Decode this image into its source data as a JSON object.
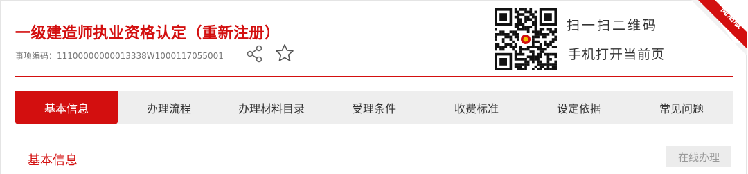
{
  "header": {
    "title": "一级建造师执业资格认定（重新注册）",
    "item_code": "事项编码：11100000000013338W1000117055001"
  },
  "qr": {
    "line1": "扫一扫二维码",
    "line2": "手机打开当前页"
  },
  "corner_badge": {
    "go": "GO",
    "label": "简洁版"
  },
  "tabs": [
    {
      "label": "基本信息",
      "active": true
    },
    {
      "label": "办理流程",
      "active": false
    },
    {
      "label": "办理材料目录",
      "active": false
    },
    {
      "label": "受理条件",
      "active": false
    },
    {
      "label": "收费标准",
      "active": false
    },
    {
      "label": "设定依据",
      "active": false
    },
    {
      "label": "常见问题",
      "active": false
    }
  ],
  "section": {
    "title": "基本信息",
    "online_button": "在线办理"
  },
  "colors": {
    "brand_red": "#d30f0f",
    "tab_bar_bg": "#eeeeee",
    "button_bg": "#ececec"
  },
  "icons": [
    "share-icon",
    "star-icon",
    "qr-code",
    "emblem-icon"
  ]
}
